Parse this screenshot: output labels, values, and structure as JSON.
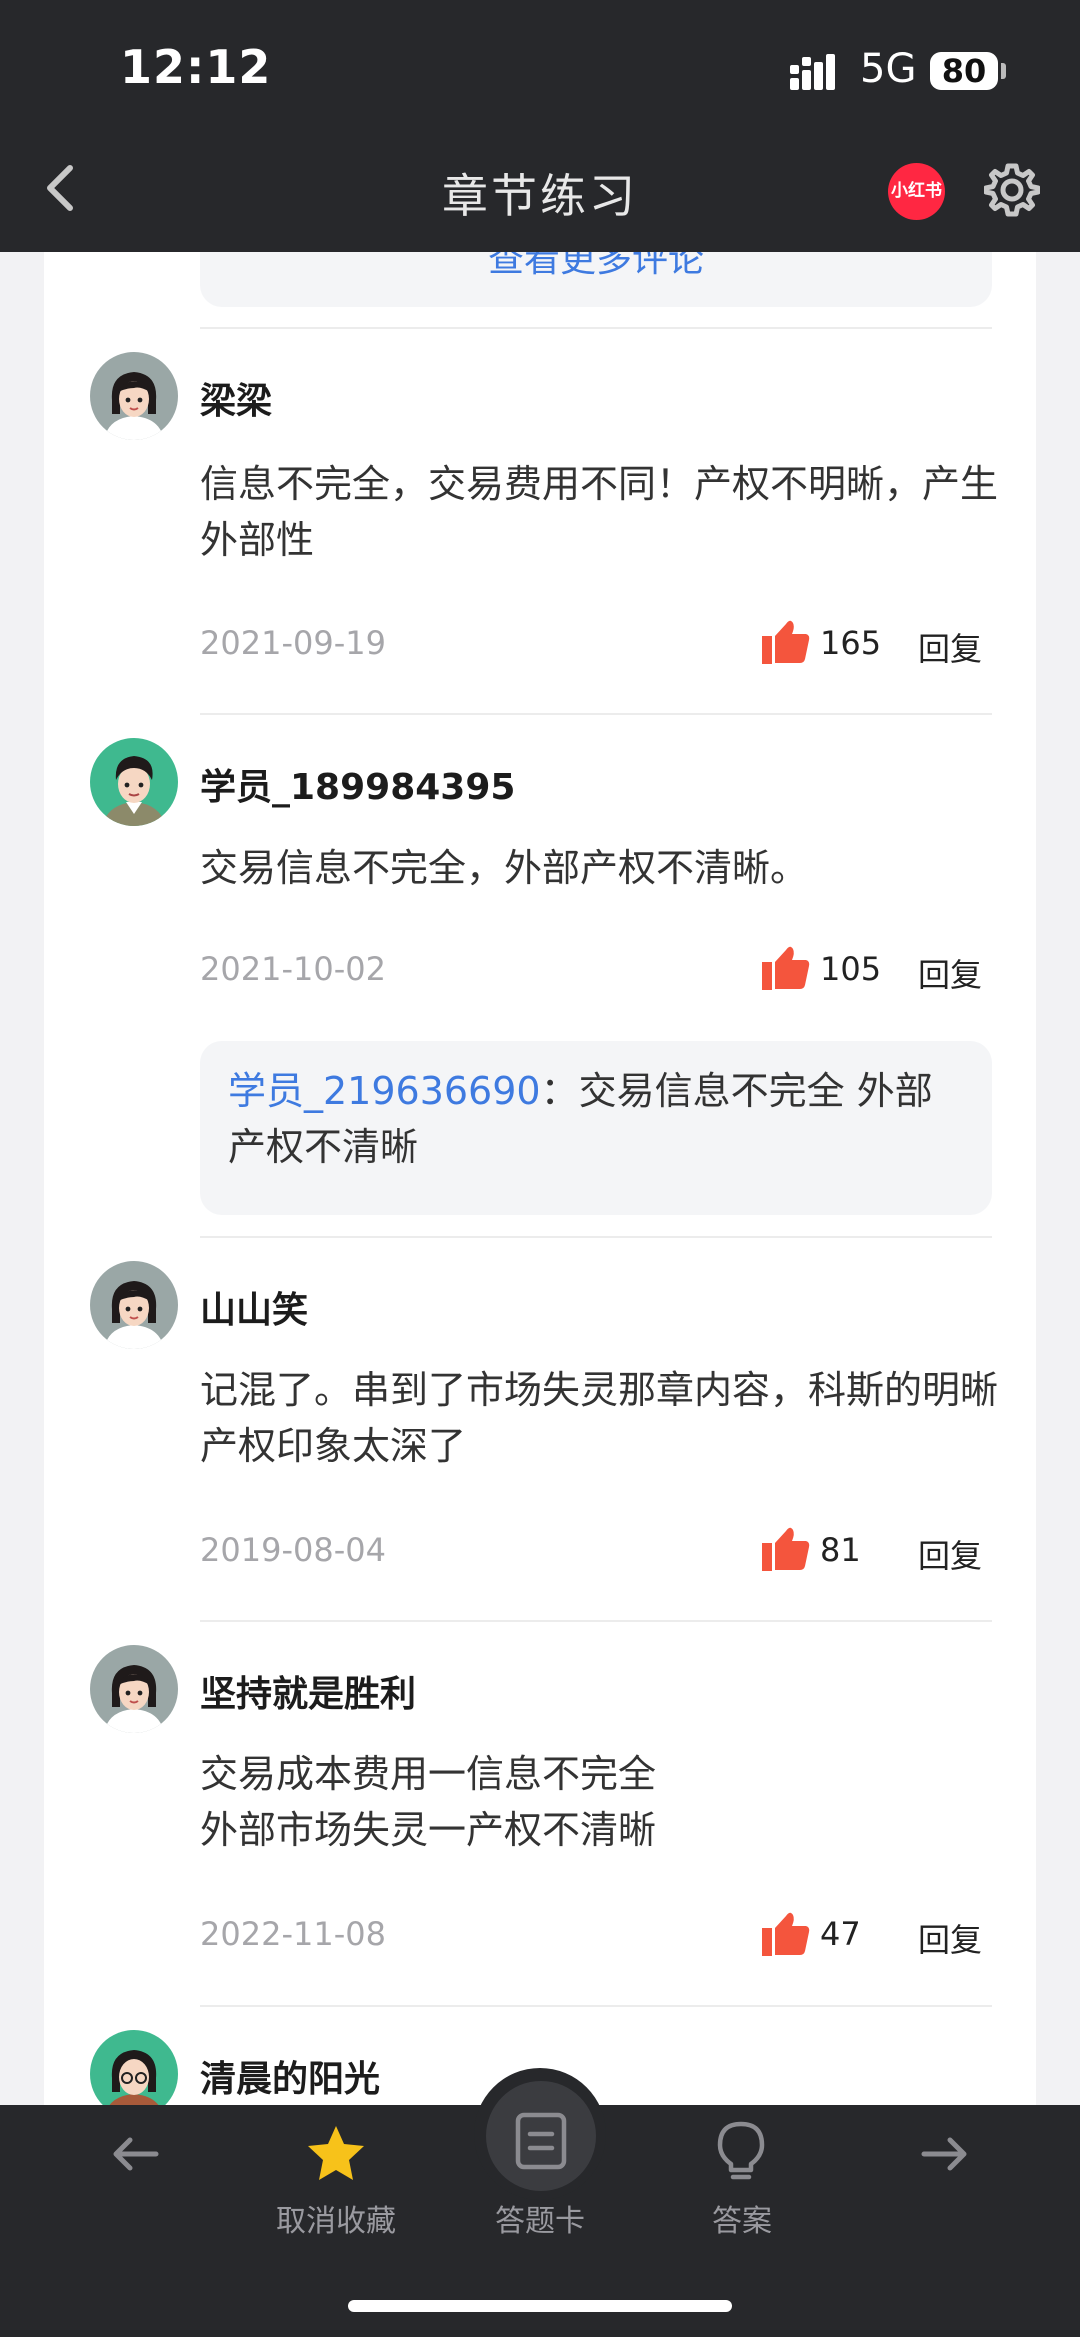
{
  "status_bar": {
    "time": "12:12",
    "network": "5G",
    "battery": "80"
  },
  "nav": {
    "title": "章节练习",
    "badge": "小红书"
  },
  "top_reply": {
    "link": "查看更多评论"
  },
  "comments": [
    {
      "user": "梁梁",
      "text": "信息不完全，交易费用不同！产权不明晰，产生外部性",
      "date": "2021-09-19",
      "likes": "165",
      "reply_label": "回复"
    },
    {
      "user": "学员_189984395",
      "text": "交易信息不完全，外部产权不清晰。",
      "date": "2021-10-02",
      "likes": "105",
      "reply_label": "回复",
      "reply": {
        "user": "学员_219636690",
        "sep": "：",
        "text": "交易信息不完全 外部产权不清晰"
      }
    },
    {
      "user": "山山笑",
      "text": "记混了。串到了市场失灵那章内容，科斯的明晰产权印象太深了",
      "date": "2019-08-04",
      "likes": "81",
      "reply_label": "回复"
    },
    {
      "user": "坚持就是胜利",
      "text_line1": "交易成本费用一信息不完全",
      "text_line2": "外部市场失灵一产权不清晰",
      "date": "2022-11-08",
      "likes": "47",
      "reply_label": "回复"
    },
    {
      "user": "清晨的阳光"
    }
  ],
  "bottom_nav": {
    "fav_label": "取消收藏",
    "card_label": "答题卡",
    "answer_label": "答案"
  },
  "colors": {
    "accent_blue": "#3e7ae0",
    "like_red": "#f4553d",
    "star_yellow": "#f7c21a",
    "dark_bar": "#27282b"
  }
}
